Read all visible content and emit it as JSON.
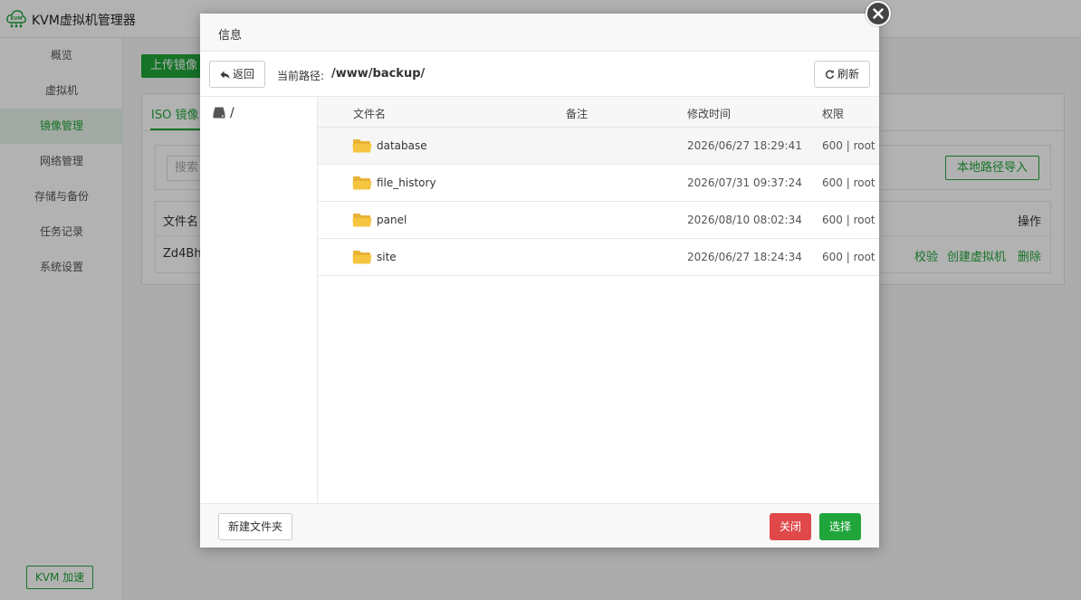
{
  "app": {
    "title": "KVM虚拟机管理器",
    "logo_text": "KVM",
    "accent": "#20a53a"
  },
  "sidebar": {
    "items": [
      {
        "label": "概览",
        "active": false
      },
      {
        "label": "虚拟机",
        "active": false
      },
      {
        "label": "镜像管理",
        "active": true
      },
      {
        "label": "网络管理",
        "active": false
      },
      {
        "label": "存储与备份",
        "active": false
      },
      {
        "label": "任务记录",
        "active": false
      },
      {
        "label": "系统设置",
        "active": false
      }
    ],
    "accel_label": "KVM 加速"
  },
  "background": {
    "upload_label": "上传镜像",
    "tab_label": "ISO 镜像",
    "search_placeholder": "搜索",
    "local_import_label": "本地路径导入",
    "col_name": "文件名",
    "col_ops": "操作",
    "row_name": "Zd4Bh",
    "actions": [
      "校验",
      "创建虚拟机",
      "删除"
    ]
  },
  "modal": {
    "title": "信息",
    "back_label": "返回",
    "path_label": "当前路径:",
    "path_value": "/www/backup/",
    "refresh_label": "刷新",
    "tree_root": "/",
    "columns": {
      "name": "文件名",
      "note": "备注",
      "mtime": "修改时间",
      "perm": "权限"
    },
    "files": [
      {
        "name": "database",
        "note": "",
        "mtime": "2026/06/27 18:29:41",
        "perm": "600 | root"
      },
      {
        "name": "file_history",
        "note": "",
        "mtime": "2026/07/31 09:37:24",
        "perm": "600 | root"
      },
      {
        "name": "panel",
        "note": "",
        "mtime": "2026/08/10 08:02:34",
        "perm": "600 | root"
      },
      {
        "name": "site",
        "note": "",
        "mtime": "2026/06/27 18:24:34",
        "perm": "600 | root"
      }
    ],
    "new_folder_label": "新建文件夹",
    "close_label": "关闭",
    "select_label": "选择",
    "close_color": "#e0484a",
    "select_color": "#20a53a",
    "folder_color": "#f5c542"
  }
}
